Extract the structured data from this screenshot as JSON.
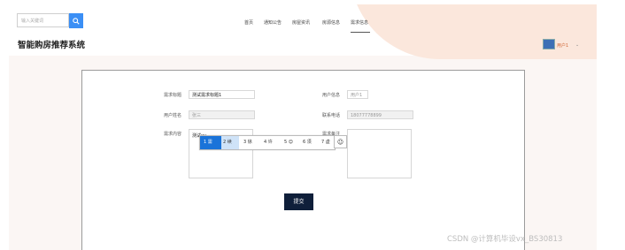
{
  "header": {
    "search_placeholder": "输入关键词",
    "nav": [
      "首页",
      "通知公告",
      "房屋资讯",
      "房源信息",
      "需求信息"
    ],
    "site_title": "智能购房推荐系统",
    "user": "用户1"
  },
  "form": {
    "title_label": "需求标题",
    "title_value": "测试需求标题1",
    "user_info_label": "用户信息",
    "user_info_value": "用户1",
    "name_label": "用户姓名",
    "name_value": "张三",
    "phone_label": "联系电话",
    "phone_value": "18077778899",
    "content_label": "需求内容",
    "content_value": "测试xu",
    "remark_label": "需求备注",
    "submit_label": "提交"
  },
  "ime": {
    "candidates": [
      "1 需",
      "2 续",
      "3 徐",
      "4 许",
      "5 😊",
      "6 须",
      "7 虚"
    ],
    "emoji": "☺"
  },
  "watermark": "CSDN @计算机毕设vx_BS30813"
}
